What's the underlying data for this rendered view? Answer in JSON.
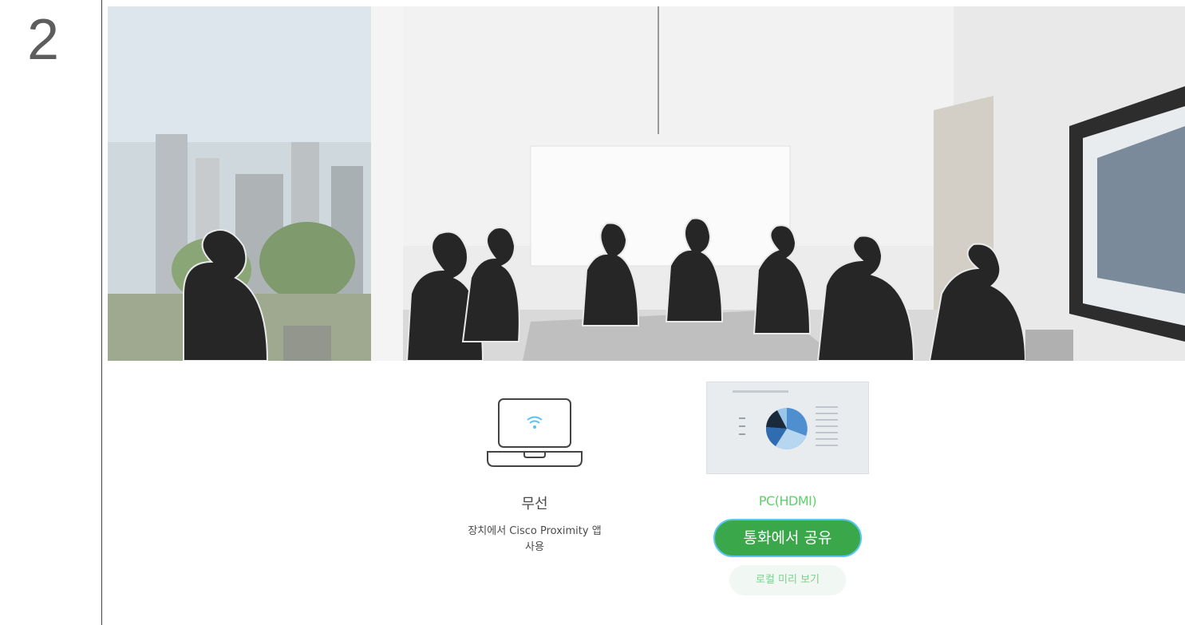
{
  "step": {
    "number": "2"
  },
  "scene": {
    "description_icon": "meeting-room-photo-icon"
  },
  "sources": {
    "wireless": {
      "icon": "wireless-laptop-icon",
      "label": "무선",
      "description_line1": "장치에서 Cisco Proximity 앱",
      "description_line2": "사용"
    },
    "hdmi": {
      "thumbnail_icon": "presentation-pie-chart-thumbnail-icon",
      "label": "PC(HDMI)",
      "share_label": "통화에서 공유",
      "preview_label": "로컬 미리 보기"
    }
  },
  "colors": {
    "accent_green": "#3aa84a",
    "focus_blue": "#5bc6f4",
    "label_green": "#5ed06c"
  }
}
